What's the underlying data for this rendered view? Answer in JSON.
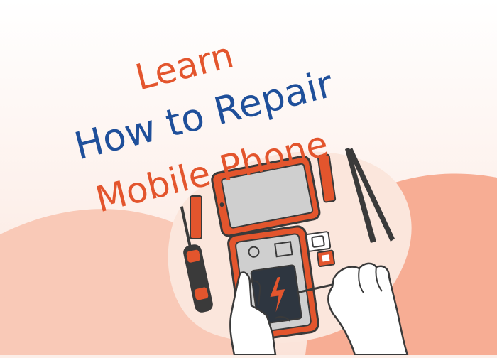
{
  "headline": {
    "line1": "Learn",
    "line2": "How to Repair",
    "line3": "Mobile Phone"
  },
  "colors": {
    "background": "#fcefe9",
    "wave_light": "#f9c9b7",
    "wave_dark": "#f7ad94",
    "blob": "#fbe6dc",
    "accent_orange": "#e3552d",
    "accent_blue": "#1f4f9a",
    "outline": "#3a3a3a",
    "screen_grey": "#cfcfcf",
    "battery_dark": "#2e3640"
  },
  "icons": [
    "screwdriver-icon",
    "tweezers-icon",
    "smartphone-icon",
    "battery-icon",
    "sim-tray-icon",
    "sim-card-icon",
    "hand-icon",
    "pry-tool-icon"
  ]
}
